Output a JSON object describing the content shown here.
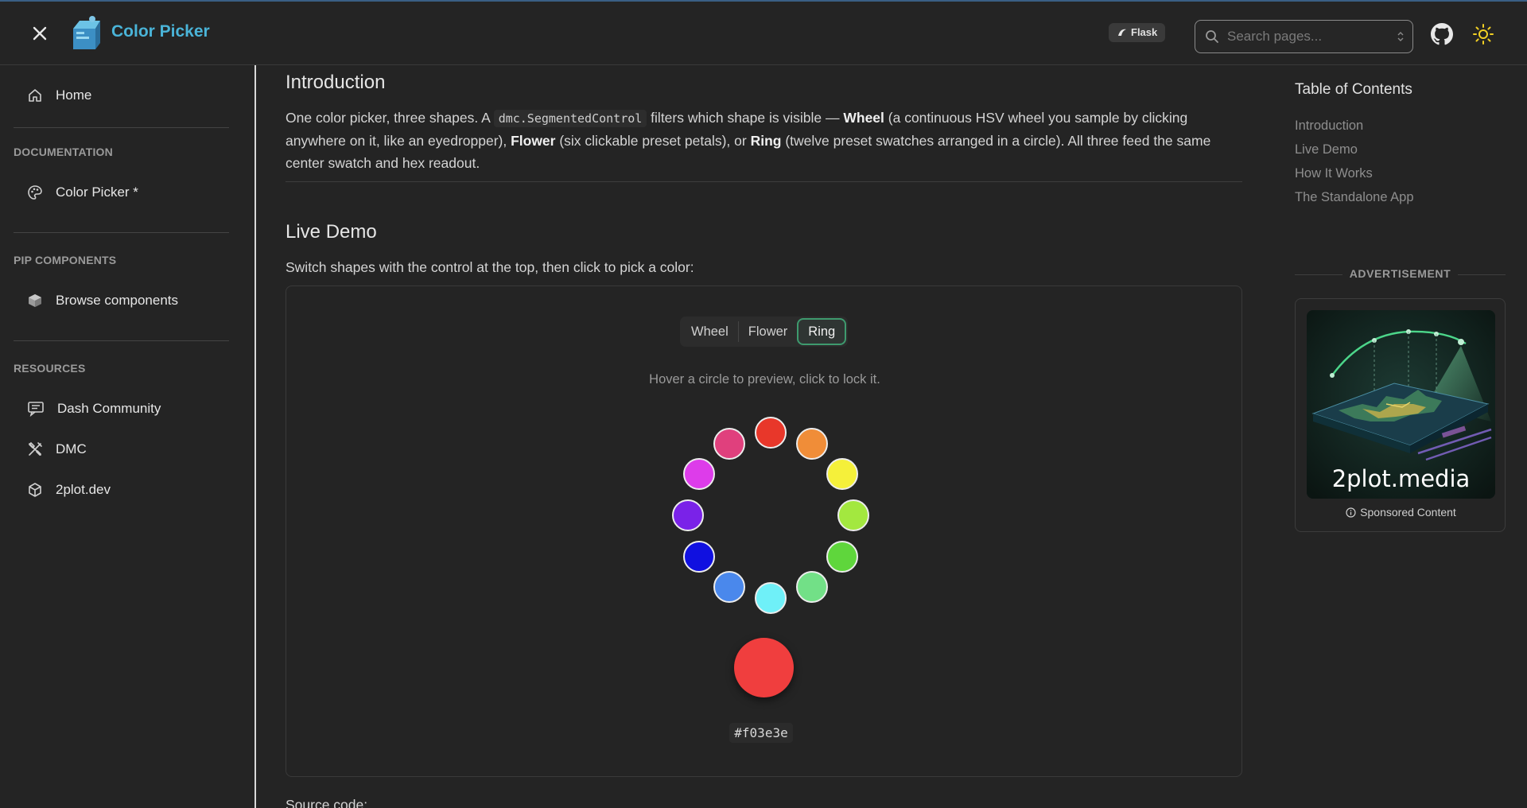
{
  "header": {
    "title": "Color Picker",
    "framework_badge": "Flask",
    "search_placeholder": "Search pages..."
  },
  "sidebar": {
    "home": "Home",
    "sections": [
      {
        "label": "DOCUMENTATION",
        "items": [
          {
            "label": "Color Picker *",
            "icon": "palette-icon"
          }
        ]
      },
      {
        "label": "PIP COMPONENTS",
        "items": [
          {
            "label": "Browse components",
            "icon": "package-icon"
          }
        ]
      },
      {
        "label": "RESOURCES",
        "items": [
          {
            "label": "Dash Community",
            "icon": "forum-icon"
          },
          {
            "label": "DMC",
            "icon": "tools-icon"
          },
          {
            "label": "2plot.dev",
            "icon": "cube-icon"
          }
        ]
      }
    ]
  },
  "main": {
    "intro_heading": "Introduction",
    "intro": {
      "p1": "One color picker, three shapes. A ",
      "code": "dmc.SegmentedControl",
      "p2": " filters which shape is visible — ",
      "b1": "Wheel",
      "p3": " (a continuous HSV wheel you sample by clicking anywhere on it, like an eyedropper), ",
      "b2": "Flower",
      "p4": " (six clickable preset petals), or ",
      "b3": "Ring",
      "p5": " (twelve preset swatches arranged in a circle). All three feed the same center swatch and hex readout."
    },
    "demo_heading": "Live Demo",
    "demo_text": "Switch shapes with the control at the top, then click to pick a color:",
    "segmented": {
      "options": [
        "Wheel",
        "Flower",
        "Ring"
      ],
      "selected": "Ring"
    },
    "hint": "Hover a circle to preview, click to lock it.",
    "ring_colors": [
      "#e8372a",
      "#f08d38",
      "#f5f03a",
      "#a3e83f",
      "#5fd63c",
      "#72e087",
      "#6ff0f8",
      "#4a88ec",
      "#1010e0",
      "#7a22e8",
      "#dd3cea",
      "#e0407d"
    ],
    "selected_color": "#f03e3e",
    "hex_readout": "#f03e3e",
    "source_label": "Source code:"
  },
  "toc": {
    "title": "Table of Contents",
    "links": [
      "Introduction",
      "Live Demo",
      "How It Works",
      "The Standalone App"
    ]
  },
  "ad": {
    "label": "ADVERTISEMENT",
    "brand": "2plot.media",
    "sponsored": "Sponsored Content"
  }
}
